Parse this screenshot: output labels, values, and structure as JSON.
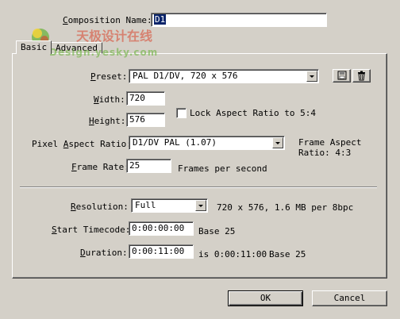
{
  "composition_name": {
    "label": "Composition Name:",
    "value": "D1"
  },
  "tabs": [
    {
      "label": "Basic",
      "active": true
    },
    {
      "label": "Advanced",
      "active": false
    }
  ],
  "watermark": {
    "line1": "天极设计在线",
    "line2": "Design.yesky.com"
  },
  "preset": {
    "label": "Preset:",
    "value": "PAL D1/DV, 720 x 576"
  },
  "width": {
    "label": "Width:",
    "value": "720"
  },
  "height": {
    "label": "Height:",
    "value": "576"
  },
  "lock_aspect": {
    "label": "Lock Aspect Ratio to 5:4",
    "checked": false
  },
  "pixel_aspect": {
    "label": "Pixel Aspect Ratio:",
    "value": "D1/DV PAL (1.07)",
    "frame_aspect_line1": "Frame Aspect",
    "frame_aspect_line2": "Ratio: 4:3"
  },
  "frame_rate": {
    "label": "Frame Rate:",
    "value": "25",
    "unit": "Frames per second"
  },
  "resolution": {
    "label": "Resolution:",
    "value": "Full",
    "info": "720 x 576, 1.6 MB per 8bpc"
  },
  "start_timecode": {
    "label": "Start Timecode:",
    "value": "0:00:00:00",
    "base": "Base 25"
  },
  "duration": {
    "label": "Duration:",
    "value": "0:00:11:00",
    "info": "is 0:00:11:00",
    "base": "Base 25"
  },
  "buttons": {
    "ok": "OK",
    "cancel": "Cancel"
  },
  "colors": {
    "dialog_bg": "#d4d0c8",
    "selection_bg": "#0a246a",
    "watermark_green": "#6cb33f",
    "watermark_red": "#d9432b"
  }
}
